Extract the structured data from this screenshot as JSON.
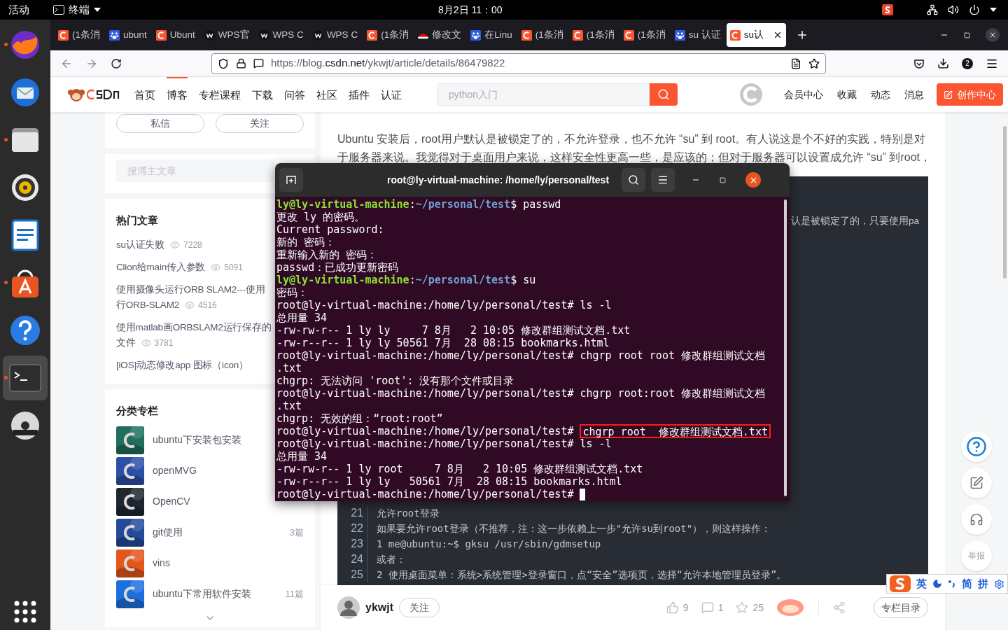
{
  "top_bar": {
    "activities": "活动",
    "app_menu": "终端",
    "clock": "8月2日 11：00"
  },
  "dock": [
    {
      "kind": "browser",
      "running": true,
      "active": false
    },
    {
      "kind": "mail",
      "running": false,
      "active": false
    },
    {
      "kind": "files",
      "running": true,
      "active": false
    },
    {
      "kind": "music",
      "running": false,
      "active": false
    },
    {
      "kind": "writer",
      "running": false,
      "active": false
    },
    {
      "kind": "store",
      "running": true,
      "active": false
    },
    {
      "kind": "help",
      "running": false,
      "active": false
    },
    {
      "kind": "terminal",
      "running": true,
      "active": true
    },
    {
      "kind": "disc",
      "running": false,
      "active": false
    }
  ],
  "tabs": [
    {
      "kind": "csdn",
      "label": "(1条消",
      "selected": false
    },
    {
      "kind": "paw",
      "label": "ubunt",
      "selected": false
    },
    {
      "kind": "csdn",
      "label": "Ubunt",
      "selected": false
    },
    {
      "kind": "wps",
      "label": "WPS官",
      "selected": false
    },
    {
      "kind": "wps",
      "label": "WPS C",
      "selected": false
    },
    {
      "kind": "wps",
      "label": "WPS C",
      "selected": false
    },
    {
      "kind": "csdn",
      "label": "(1条消",
      "selected": false
    },
    {
      "kind": "hat",
      "label": "修改文",
      "selected": false
    },
    {
      "kind": "paw",
      "label": "在Linu",
      "selected": false
    },
    {
      "kind": "csdn",
      "label": "(1条消",
      "selected": false
    },
    {
      "kind": "csdn",
      "label": "(1条消",
      "selected": false
    },
    {
      "kind": "csdn",
      "label": "(1条消",
      "selected": false
    },
    {
      "kind": "paw",
      "label": "su 认证",
      "selected": false
    },
    {
      "kind": "csdn",
      "label": "su认",
      "selected": true
    }
  ],
  "address_bar": {
    "url": "https://blog.**csdn.net**/ykwjt/article/details/86479822",
    "account_badge": "2"
  },
  "csdn_header": {
    "nav": [
      {
        "label": "首页",
        "selected": false
      },
      {
        "label": "博客",
        "selected": true
      },
      {
        "label": "专栏课程",
        "selected": false
      },
      {
        "label": "下载",
        "selected": false
      },
      {
        "label": "问答",
        "selected": false
      },
      {
        "label": "社区",
        "selected": false
      },
      {
        "label": "插件",
        "selected": false
      },
      {
        "label": "认证",
        "selected": false
      }
    ],
    "search_placeholder": "python入门",
    "links": [
      "会员中心",
      "收藏",
      "动态",
      "消息"
    ],
    "create_button": "创作中心"
  },
  "author_card": {
    "buttons": [
      "私信",
      "关注"
    ],
    "search_placeholder": "搜博主文章"
  },
  "hot_articles": {
    "title": "热门文章",
    "items": [
      {
        "lines": [
          "su认证失败"
        ],
        "views": "7228"
      },
      {
        "lines": [
          "Clion给main传入参数"
        ],
        "views": "5091"
      },
      {
        "lines": [
          "使用摄像头运行ORB SLAM2---使用",
          "行ORB-SLAM2"
        ],
        "views": "4516"
      },
      {
        "lines": [
          "使用matlab画ORBSLAM2运行保存的",
          "文件"
        ],
        "views": "3781"
      },
      {
        "lines": [
          "[iOS]动态修改app 图标（icon）"
        ]
      }
    ]
  },
  "columns": {
    "title": "分类专栏",
    "items": [
      {
        "name": "ubuntu下安装包安装"
      },
      {
        "name": "openMVG"
      },
      {
        "name": "OpenCV"
      },
      {
        "name": "git使用",
        "count": "3篇"
      },
      {
        "name": "vins"
      },
      {
        "name": "ubuntu下常用软件安装",
        "count": "11篇"
      }
    ]
  },
  "article": {
    "paragraph": "Ubuntu 安装后，root用户默认是被锁定了的，不允许登录，也不允许 “su” 到 root。有人说这是个不好的实践，特别是对于服务器来说。我觉得对于桌面用户来说，这样安全性更高一些，是应该的；但对于服务器可以设置成允许 “su” 到root，",
    "code_fragment": "认是被锁定了的，只要使用pa",
    "code_lines": [
      {
        "number": "21",
        "text": "允许root登录"
      },
      {
        "number": "22",
        "text": "如果要允许root登录（不推荐，注：这一步依赖上一步\"允许su到root\"），则这样操作："
      },
      {
        "number": "23",
        "text": "1 me@ubuntu:~$ gksu /usr/sbin/gdmsetup"
      },
      {
        "number": "24",
        "text": "或者："
      },
      {
        "number": "25",
        "text": "2 使用桌面菜单：系统>系统管理>登录窗口，点“安全”选项页，选择“允许本地管理员登录”。"
      }
    ]
  },
  "article_footer": {
    "author": "ykwjt",
    "follow": "关注",
    "likes": "9",
    "comments": "1",
    "favorites": "25",
    "catalog_button": "专栏目录"
  },
  "side_tools": {
    "report": "举报"
  },
  "terminal": {
    "title": "root@ly-virtual-machine: /home/ly/personal/test",
    "lines": [
      {
        "kind": "user_prompt",
        "user": "ly@ly-virtual-machine",
        "separator": ":",
        "path": "~/personal/test",
        "command": "$ passwd"
      },
      {
        "kind": "output",
        "text": "更改 ly 的密码。"
      },
      {
        "kind": "output",
        "text": "Current password:"
      },
      {
        "kind": "output",
        "text": "新的 密码："
      },
      {
        "kind": "output",
        "text": "重新输入新的 密码："
      },
      {
        "kind": "output",
        "text": "passwd：已成功更新密码"
      },
      {
        "kind": "user_prompt",
        "user": "ly@ly-virtual-machine",
        "separator": ":",
        "path": "~/personal/test",
        "command": "$ su"
      },
      {
        "kind": "output",
        "text": "密码："
      },
      {
        "kind": "output",
        "text": "root@ly-virtual-machine:/home/ly/personal/test# ls -l"
      },
      {
        "kind": "output",
        "text": "总用量 34"
      },
      {
        "kind": "output",
        "text": "-rw-rw-r-- 1 ly ly     7 8月   2 10:05 修改群组测试文档.txt"
      },
      {
        "kind": "output",
        "text": "-rw-r--r-- 1 ly ly 50561 7月  28 08:15 bookmarks.html"
      },
      {
        "kind": "output",
        "text": "root@ly-virtual-machine:/home/ly/personal/test# chgrp root root 修改群组测试文档"
      },
      {
        "kind": "output",
        "text": ".txt"
      },
      {
        "kind": "output",
        "text": "chgrp: 无法访问 'root': 没有那个文件或目录"
      },
      {
        "kind": "output",
        "text": "root@ly-virtual-machine:/home/ly/personal/test# chgrp root:root 修改群组测试文档"
      },
      {
        "kind": "output",
        "text": ".txt"
      },
      {
        "kind": "output",
        "text": "chgrp: 无效的组：“root:root”"
      },
      {
        "kind": "highlighted",
        "text": "root@ly-virtual-machine:/home/ly/personal/test#",
        "command": "chgrp root  修改群组测试文档.txt"
      },
      {
        "kind": "output",
        "text": "root@ly-virtual-machine:/home/ly/personal/test# ls -l"
      },
      {
        "kind": "output",
        "text": "总用量 34"
      },
      {
        "kind": "output",
        "text": "-rw-rw-r-- 1 ly root     7 8月   2 10:05 修改群组测试文档.txt"
      },
      {
        "kind": "output",
        "text": "-rw-r--r-- 1 ly ly   50561 7月  28 08:15 bookmarks.html"
      },
      {
        "kind": "cursor",
        "text": "root@ly-virtual-machine:/home/ly/personal/test#"
      }
    ]
  },
  "ime_bar": {
    "mode": "英",
    "script": "简",
    "input": "拼"
  }
}
